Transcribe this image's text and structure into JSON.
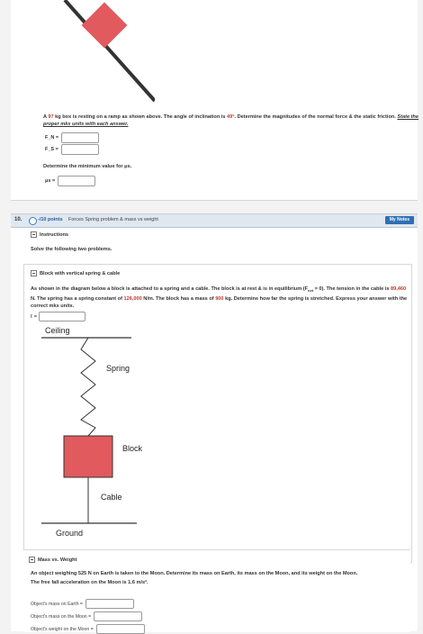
{
  "problem_a": {
    "text_prefix": "A ",
    "mass": "97",
    "text_mid": " kg box is resting on a ramp as shown above. The angle of inclination is ",
    "angle": "49°",
    "text_suffix": ". Determine the magnitudes of the normal force & the static friction. ",
    "instruction": "State the proper mks units with each answer.",
    "fn_label": "F_N =",
    "fs_label": "F_S =",
    "determine_text": "Determine the minimum value for μs.",
    "mu_label": "μs ="
  },
  "question": {
    "number": "10.",
    "points": "-/10 points",
    "tags": "Forces  Spring problem & mass vs weight",
    "my_notes": "My Notes"
  },
  "instructions": {
    "heading": "Instructions",
    "text": "Solve the following two problems."
  },
  "block_problem": {
    "heading": "Block with vertical spring & cable",
    "p1": "As shown in the diagram below a block is attached to a spring and a cable. The block is at rest & is in equilibrium (F",
    "p1_sub": "net",
    "p1b": " = 0). The tension in the cable is ",
    "tension": "89,460",
    "p2": " N. The spring has a spring constant of ",
    "spring_k": "126,000",
    "p3": " N/m. The block has a mass of ",
    "block_mass": "900",
    "p4": " kg. Determine how far the spring is stretched. Express your answer with the correct mks units.",
    "answer_label": "ℓ ="
  },
  "diagram": {
    "ceiling": "Ceiling",
    "spring": "Spring",
    "block": "Block",
    "cable": "Cable",
    "ground": "Ground"
  },
  "mass_weight": {
    "heading": "Mass vs. Weight",
    "text1": "An object weighing 525 N on Earth is taken to the Moon. Determine its mass on Earth, its mass on the Moon, and its weight on the Moon.",
    "text2": "The free fall acceleration on the Moon is 1.6 m/s².",
    "row1": "Object's mass on Earth =",
    "row2": "Object's mass on the Moon =",
    "row3": "Object's weight on the Moon ="
  },
  "colors": {
    "block_fill": "#e05a5e",
    "accent": "#2f6fb3",
    "highlight_red": "#c0392b"
  }
}
